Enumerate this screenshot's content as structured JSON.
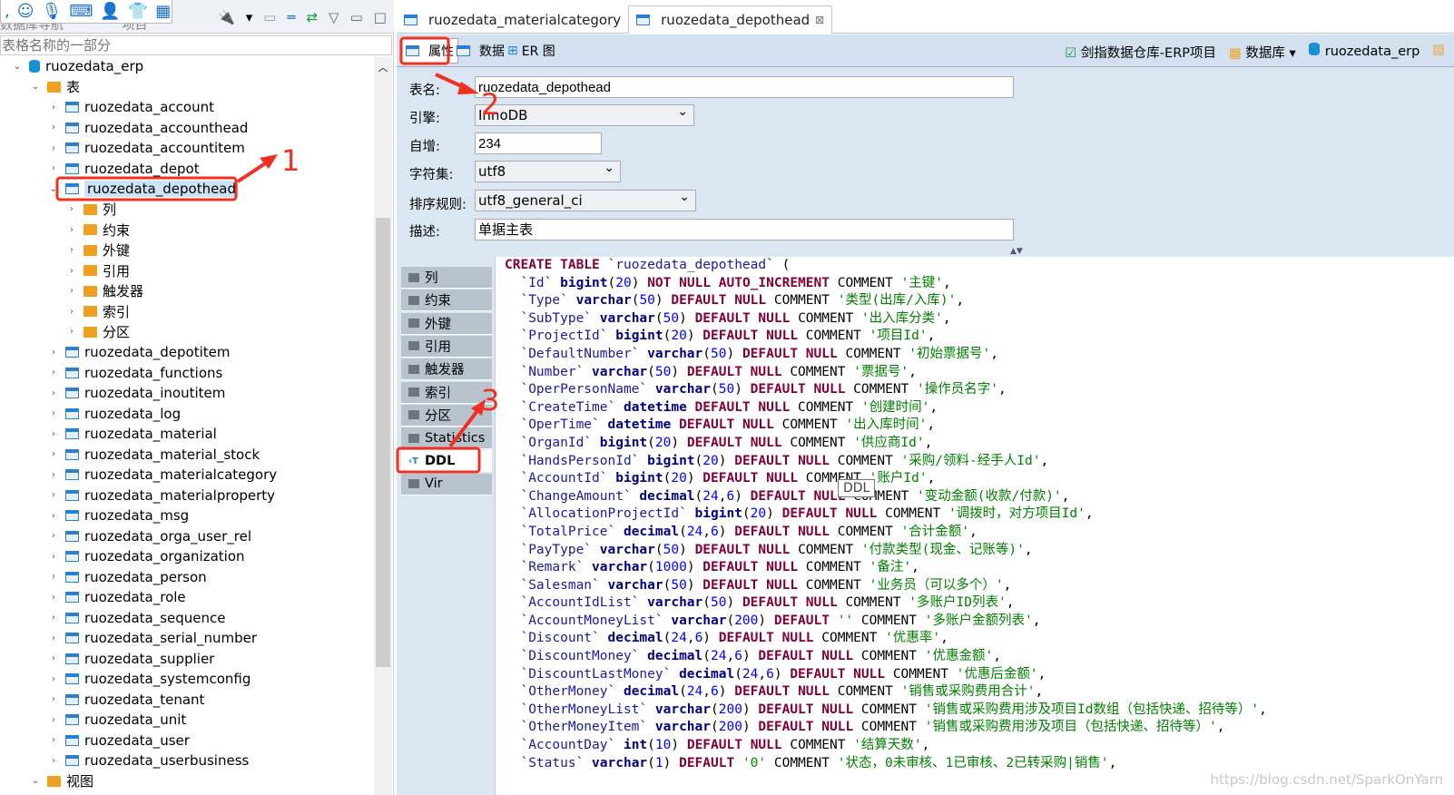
{
  "ime_toolbar": [
    "comma-icon",
    "smiley-icon",
    "microphone-icon",
    "keyboard-icon",
    "user-card-icon",
    "tshirt-icon",
    "grid-icon"
  ],
  "left_panel": {
    "tabs": [
      "数据库导航",
      "项目"
    ],
    "filter_placeholder": "表格名称的一部分",
    "connection": "ruozedata_erp",
    "tables_folder": "表",
    "tables_before": [
      "ruozedata_account",
      "ruozedata_accounthead",
      "ruozedata_accountitem",
      "ruozedata_depot"
    ],
    "selected_table": "ruozedata_depothead",
    "selected_children": [
      "列",
      "约束",
      "外键",
      "引用",
      "触发器",
      "索引",
      "分区"
    ],
    "tables_after": [
      "ruozedata_depotitem",
      "ruozedata_functions",
      "ruozedata_inoutitem",
      "ruozedata_log",
      "ruozedata_material",
      "ruozedata_material_stock",
      "ruozedata_materialcategory",
      "ruozedata_materialproperty",
      "ruozedata_msg",
      "ruozedata_orga_user_rel",
      "ruozedata_organization",
      "ruozedata_person",
      "ruozedata_role",
      "ruozedata_sequence",
      "ruozedata_serial_number",
      "ruozedata_supplier",
      "ruozedata_systemconfig",
      "ruozedata_tenant",
      "ruozedata_unit",
      "ruozedata_user",
      "ruozedata_userbusiness"
    ],
    "views_folder": "视图"
  },
  "editor": {
    "tabs": [
      {
        "label": "ruozedata_materialcategory",
        "active": false
      },
      {
        "label": "ruozedata_depothead",
        "active": true
      }
    ],
    "subtabs": [
      "属性",
      "数据",
      "ER 图"
    ],
    "breadcrumbs": [
      "剑指数据仓库-ERP项目",
      "数据库",
      "ruozedata_erp"
    ],
    "props": {
      "name_label": "表名:",
      "name": "ruozedata_depothead",
      "engine_label": "引擎:",
      "engine": "InnoDB",
      "autoinc_label": "自增:",
      "autoinc": "234",
      "charset_label": "字符集:",
      "charset": "utf8",
      "collation_label": "排序规则:",
      "collation": "utf8_general_ci",
      "desc_label": "描述:",
      "desc": "单据主表"
    },
    "vtabs": [
      "列",
      "约束",
      "外键",
      "引用",
      "触发器",
      "索引",
      "分区",
      "Statistics",
      "DDL",
      "Vir"
    ],
    "active_vtab": "DDL",
    "tooltip": "DDL",
    "ddl": [
      "CREATE TABLE `ruozedata_depothead` (",
      "  `Id` bigint(20) NOT NULL AUTO_INCREMENT COMMENT '主键',",
      "  `Type` varchar(50) DEFAULT NULL COMMENT '类型(出库/入库)',",
      "  `SubType` varchar(50) DEFAULT NULL COMMENT '出入库分类',",
      "  `ProjectId` bigint(20) DEFAULT NULL COMMENT '项目Id',",
      "  `DefaultNumber` varchar(50) DEFAULT NULL COMMENT '初始票据号',",
      "  `Number` varchar(50) DEFAULT NULL COMMENT '票据号',",
      "  `OperPersonName` varchar(50) DEFAULT NULL COMMENT '操作员名字',",
      "  `CreateTime` datetime DEFAULT NULL COMMENT '创建时间',",
      "  `OperTime` datetime DEFAULT NULL COMMENT '出入库时间',",
      "  `OrganId` bigint(20) DEFAULT NULL COMMENT '供应商Id',",
      "  `HandsPersonId` bigint(20) DEFAULT NULL COMMENT '采购/领料-经手人Id',",
      "  `AccountId` bigint(20) DEFAULT NULL COMMENT '账户Id',",
      "  `ChangeAmount` decimal(24,6) DEFAULT NULL COMMENT '变动金额(收款/付款)',",
      "  `AllocationProjectId` bigint(20) DEFAULT NULL COMMENT '调拨时，对方项目Id',",
      "  `TotalPrice` decimal(24,6) DEFAULT NULL COMMENT '合计金额',",
      "  `PayType` varchar(50) DEFAULT NULL COMMENT '付款类型(现金、记账等)',",
      "  `Remark` varchar(1000) DEFAULT NULL COMMENT '备注',",
      "  `Salesman` varchar(50) DEFAULT NULL COMMENT '业务员（可以多个）',",
      "  `AccountIdList` varchar(50) DEFAULT NULL COMMENT '多账户ID列表',",
      "  `AccountMoneyList` varchar(200) DEFAULT '' COMMENT '多账户金额列表',",
      "  `Discount` decimal(24,6) DEFAULT NULL COMMENT '优惠率',",
      "  `DiscountMoney` decimal(24,6) DEFAULT NULL COMMENT '优惠金额',",
      "  `DiscountLastMoney` decimal(24,6) DEFAULT NULL COMMENT '优惠后金额',",
      "  `OtherMoney` decimal(24,6) DEFAULT NULL COMMENT '销售或采购费用合计',",
      "  `OtherMoneyList` varchar(200) DEFAULT NULL COMMENT '销售或采购费用涉及项目Id数组（包括快递、招待等）',",
      "  `OtherMoneyItem` varchar(200) DEFAULT NULL COMMENT '销售或采购费用涉及项目（包括快递、招待等）',",
      "  `AccountDay` int(10) DEFAULT NULL COMMENT '结算天数',",
      "  `Status` varchar(1) DEFAULT '0' COMMENT '状态，0未审核、1已审核、2已转采购|销售',"
    ]
  },
  "annotations": {
    "color": "#f03020",
    "labels": [
      "1",
      "2",
      "3"
    ]
  },
  "watermark": "https://blog.csdn.net/SparkOnYarn"
}
